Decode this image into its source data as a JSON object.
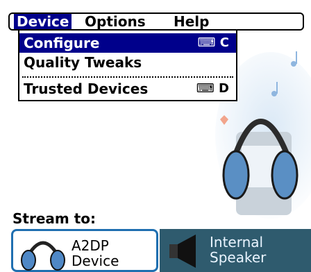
{
  "menubar": {
    "items": [
      {
        "label": "Device"
      },
      {
        "label": "Options"
      },
      {
        "label": "Help"
      }
    ]
  },
  "dropdown": {
    "items": [
      {
        "label": "Configure",
        "shortcut": "C"
      },
      {
        "label": "Quality Tweaks"
      },
      {
        "label": "Trusted Devices",
        "shortcut": "D"
      }
    ]
  },
  "stream": {
    "label": "Stream to:",
    "buttons": [
      {
        "line1": "A2DP",
        "line2": "Device"
      },
      {
        "line1": "Internal",
        "line2": "Speaker"
      }
    ]
  },
  "colors": {
    "menu_highlight": "#00008b",
    "button_border": "#1f6fb0",
    "speaker_bg": "#2f5b6e"
  }
}
